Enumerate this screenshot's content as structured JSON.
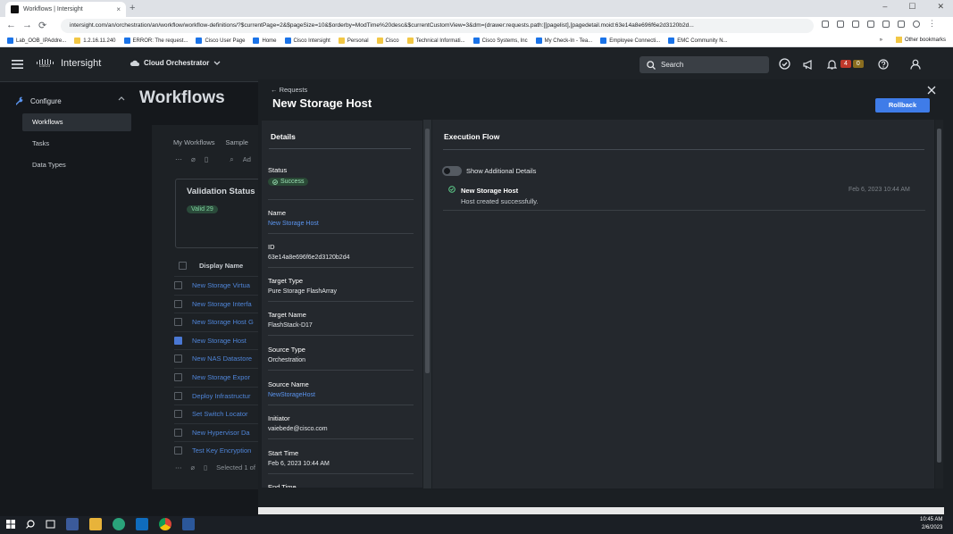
{
  "browser": {
    "tab_title": "Workflows | Intersight",
    "tab_close": "×",
    "new_tab": "+",
    "window_controls": [
      "–",
      "☐",
      "✕"
    ],
    "nav_back": "←",
    "nav_forward": "→",
    "nav_reload": "⟳",
    "url": "intersight.com/an/orchestration/an/workflow/workflow-definitions/?$currentPage=2&$pageSize=10&$orderby=ModTime%20desc&$currentCustomView=3&dm=(drawer:requests.path:[[pagelist],[pagedetail.moid:63e14a8e696f6e2d3120b2d...",
    "bookmarks": [
      {
        "label": "Lab_OOB_IPAddre...",
        "folder": false
      },
      {
        "label": "1.2.16.11.240",
        "folder": true
      },
      {
        "label": "ERROR: The request...",
        "folder": false
      },
      {
        "label": "Cisco User Page",
        "folder": false
      },
      {
        "label": "Home",
        "folder": false
      },
      {
        "label": "Cisco Intersight",
        "folder": false
      },
      {
        "label": "Personal",
        "folder": true
      },
      {
        "label": "Cisco",
        "folder": true
      },
      {
        "label": "Technical Informati...",
        "folder": true
      },
      {
        "label": "Cisco Systems, Inc",
        "folder": false
      },
      {
        "label": "My Check-In - Tea...",
        "folder": false
      },
      {
        "label": "Employee Connecti...",
        "folder": false
      },
      {
        "label": "EMC Community N...",
        "folder": false
      }
    ],
    "bookmarks_more": "»",
    "other_bookmarks": "Other bookmarks"
  },
  "header": {
    "app_name": "Intersight",
    "cisco_wordmark": "cisco",
    "context": "Cloud Orchestrator",
    "search_placeholder": "Search",
    "alarm_critical_count": "4",
    "alarm_warning_count": "0"
  },
  "sidebar": {
    "section": "Configure",
    "items": [
      "Workflows",
      "Tasks",
      "Data Types"
    ]
  },
  "page": {
    "title": "Workflows",
    "tabs": [
      "My Workflows",
      "Sample"
    ],
    "toolbar_add": "Ad",
    "validation_title": "Validation Status",
    "validation_badge": "Valid 29",
    "column_display_name": "Display Name",
    "rows": [
      {
        "name": "New Storage Virtua",
        "checked": false
      },
      {
        "name": "New Storage Interfa",
        "checked": false
      },
      {
        "name": "New Storage Host G",
        "checked": false
      },
      {
        "name": "New Storage Host",
        "checked": true
      },
      {
        "name": "New NAS Datastore",
        "checked": false
      },
      {
        "name": "New Storage Expor",
        "checked": false
      },
      {
        "name": "Deploy Infrastructur",
        "checked": false
      },
      {
        "name": "Set Switch Locator",
        "checked": false
      },
      {
        "name": "New Hypervisor Da",
        "checked": false
      },
      {
        "name": "Test Key Encryption",
        "checked": false
      }
    ],
    "footer_selected": "Selected 1 of"
  },
  "drawer": {
    "breadcrumb": "← Requests",
    "title": "New Storage Host",
    "rollback_label": "Rollback",
    "details_header": "Details",
    "status_label": "Status",
    "status_value": "Success",
    "fields": [
      {
        "label": "Name",
        "value": "New Storage Host",
        "link": true
      },
      {
        "label": "ID",
        "value": "63e14a8e696f6e2d3120b2d4",
        "link": false
      },
      {
        "label": "Target Type",
        "value": "Pure Storage FlashArray",
        "link": false
      },
      {
        "label": "Target Name",
        "value": "FlashStack-D17",
        "link": false
      },
      {
        "label": "Source Type",
        "value": "Orchestration",
        "link": false
      },
      {
        "label": "Source Name",
        "value": "NewStorageHost",
        "link": true
      },
      {
        "label": "Initiator",
        "value": "vaiebede@cisco.com",
        "link": false
      },
      {
        "label": "Start Time",
        "value": "Feb 6, 2023 10:44 AM",
        "link": false
      }
    ],
    "next_field_label": "End Time",
    "execution_header": "Execution Flow",
    "toggle_label": "Show Additional Details",
    "task": {
      "name": "New Storage Host",
      "message": "Host created successfully.",
      "time": "Feb 6, 2023 10:44 AM"
    }
  },
  "taskbar": {
    "time": "10:45 AM",
    "date": "2/6/2023"
  },
  "colors": {
    "accent": "#3f7ce8",
    "link": "#5b95f0",
    "success": "#9be0b4",
    "critical": "#c0392b",
    "warning": "#8a6d1f"
  }
}
